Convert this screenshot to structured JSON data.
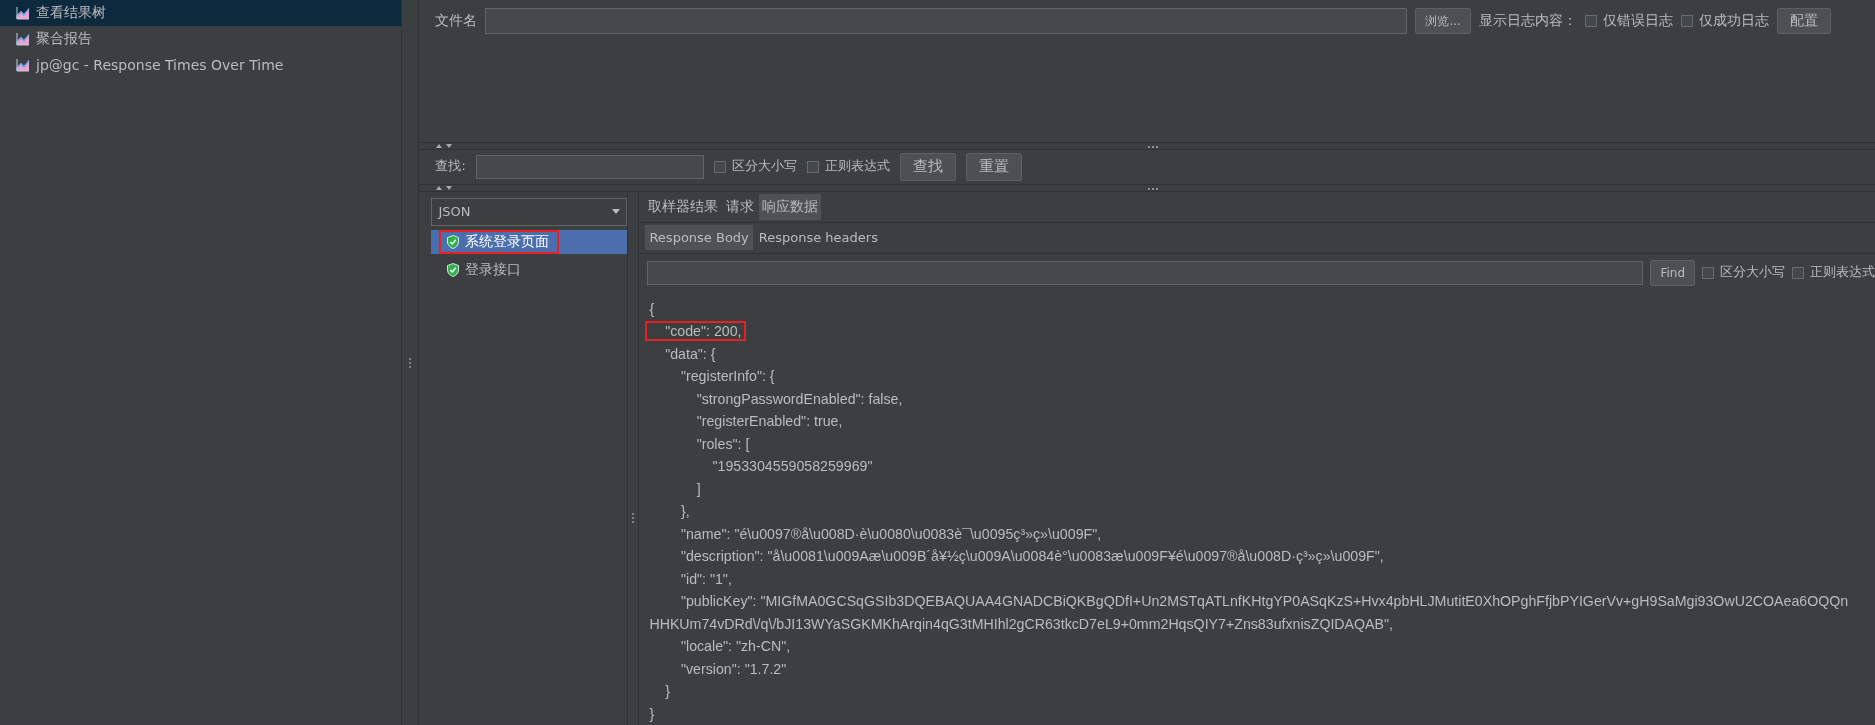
{
  "sidebar": {
    "items": [
      {
        "label": "查看结果树",
        "selected": true
      },
      {
        "label": "聚合报告",
        "selected": false
      },
      {
        "label": "jp@gc - Response Times Over Time",
        "selected": false
      }
    ]
  },
  "file_row": {
    "label": "文件名",
    "browse_button": "浏览...",
    "log_label": "显示日志内容：",
    "checkboxes": [
      {
        "label": "仅错误日志",
        "checked": false
      },
      {
        "label": "仅成功日志",
        "checked": false
      }
    ],
    "config_button": "配置"
  },
  "search_row": {
    "label": "查找:",
    "checkboxes": [
      {
        "label": "区分大小写",
        "checked": false
      },
      {
        "label": "正则表达式",
        "checked": false
      }
    ],
    "find_button": "查找",
    "reset_button": "重置"
  },
  "renderer": {
    "value": "JSON"
  },
  "sample_tree": [
    {
      "label": "系统登录页面",
      "selected": true,
      "highlighted": true
    },
    {
      "label": "登录接口",
      "selected": false,
      "highlighted": false
    }
  ],
  "tabs": [
    {
      "label": "取样器结果",
      "selected": false
    },
    {
      "label": "请求",
      "selected": false
    },
    {
      "label": "响应数据",
      "selected": true
    }
  ],
  "sub_tabs": [
    {
      "label": "Response Body",
      "selected": true
    },
    {
      "label": "Response headers",
      "selected": false
    }
  ],
  "body_find": {
    "button": "Find",
    "checkboxes": [
      {
        "label": "区分大小写",
        "checked": false
      },
      {
        "label": "正则表达式",
        "checked": false
      }
    ]
  },
  "response_lines": [
    {
      "text": "{",
      "highlighted": false
    },
    {
      "text": "    \"code\": 200,",
      "highlighted": true
    },
    {
      "text": "    \"data\": {",
      "highlighted": false
    },
    {
      "text": "        \"registerInfo\": {",
      "highlighted": false
    },
    {
      "text": "            \"strongPasswordEnabled\": false,",
      "highlighted": false
    },
    {
      "text": "            \"registerEnabled\": true,",
      "highlighted": false
    },
    {
      "text": "            \"roles\": [",
      "highlighted": false
    },
    {
      "text": "                \"1953304559058259969\"",
      "highlighted": false
    },
    {
      "text": "            ]",
      "highlighted": false
    },
    {
      "text": "        },",
      "highlighted": false
    },
    {
      "text": "        \"name\": \"é\\u0097®å\\u008D·è\\u0080\\u0083è¯\\u0095ç³»ç»\\u009F\",",
      "highlighted": false
    },
    {
      "text": "        \"description\": \"å\\u0081\\u009Aæ\\u009B´å¥½ç\\u009A\\u0084è°\\u0083æ\\u009F¥é\\u0097®å\\u008D·ç³»ç»\\u009F\",",
      "highlighted": false
    },
    {
      "text": "        \"id\": \"1\",",
      "highlighted": false
    },
    {
      "text": "        \"publicKey\": \"MIGfMA0GCSqGSIb3DQEBAQUAA4GNADCBiQKBgQDfI+Un2MSTqATLnfKHtgYP0ASqKzS+Hvx4pbHLJMutitE0XhOPghFfjbPYIGerVv+gH9SaMgi93OwU2COAea6OQQn",
      "highlighted": false
    },
    {
      "text": "HHKUm74vDRd\\/q\\/bJI13WYaSGKMKhArqin4qG3tMHIhl2gCR63tkcD7eL9+0mm2HqsQIY7+Zns83ufxnisZQIDAQAB\",",
      "highlighted": false
    },
    {
      "text": "        \"locale\": \"zh-CN\",",
      "highlighted": false
    },
    {
      "text": "        \"version\": \"1.7.2\"",
      "highlighted": false
    },
    {
      "text": "    }",
      "highlighted": false
    },
    {
      "text": "}",
      "highlighted": false
    }
  ]
}
